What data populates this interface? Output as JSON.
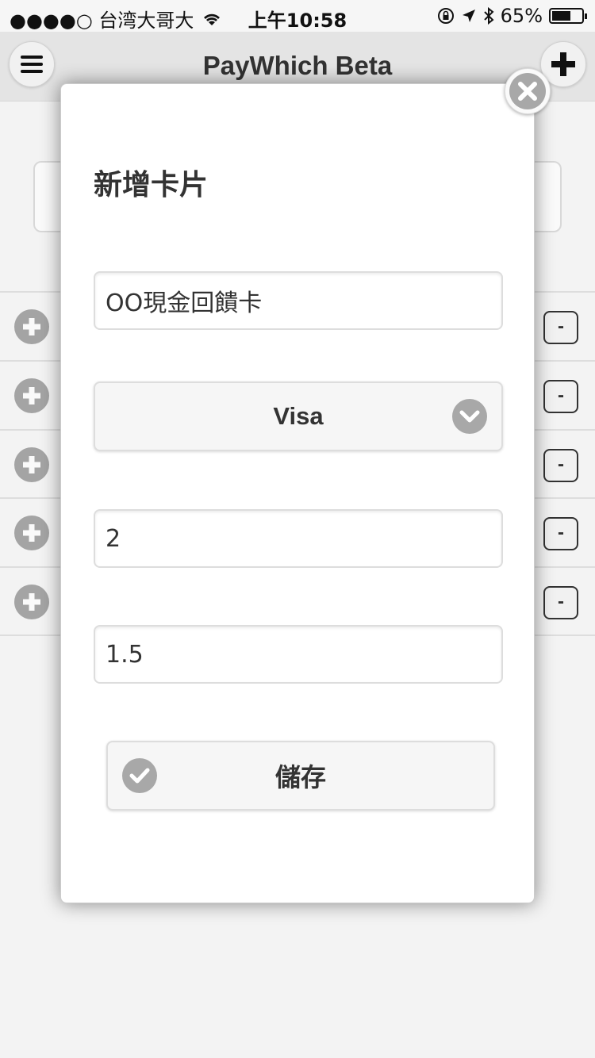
{
  "status_bar": {
    "carrier": "●●●●○ 台湾大哥大",
    "time": "上午10:58",
    "battery": "65%",
    "battery_level": 0.65
  },
  "header": {
    "title": "PayWhich Beta",
    "menu_icon": "hamburger-menu-icon",
    "add_icon": "plus-icon"
  },
  "background_rows": [
    {
      "minus_label": "-"
    },
    {
      "minus_label": "-"
    },
    {
      "minus_label": "-"
    },
    {
      "minus_label": "-"
    },
    {
      "minus_label": "-"
    }
  ],
  "dialog": {
    "title": "新增卡片",
    "card_name": "OO現金回饋卡",
    "card_type": "Visa",
    "field_two": "2",
    "field_three": "1.5",
    "save_label": "儲存",
    "close_icon": "close-icon"
  },
  "colors": {
    "icon_gray": "#a8a8a8",
    "header_bg": "#e9e9e9",
    "text": "#333333"
  }
}
